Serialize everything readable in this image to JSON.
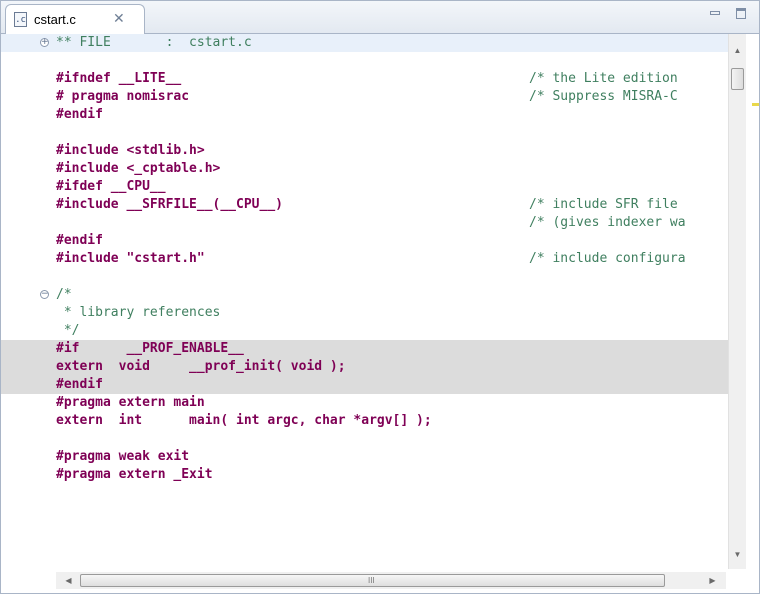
{
  "tab": {
    "icon": "c-source-file-icon",
    "icon_letter": ".c",
    "title": "cstart.c",
    "close_glyph": "✕"
  },
  "window": {
    "minimize": "minimize-icon",
    "maximize": "maximize-icon"
  },
  "scroll": {
    "up": "▲",
    "down": "▼",
    "left": "◀",
    "right": "▶",
    "grip": "III"
  },
  "editor": {
    "lines": [
      {
        "code": "** FILE       :  cstart.c"
      },
      {
        "code": ""
      },
      {
        "code": "#ifndef __LITE__",
        "comment": "/* the Lite edition"
      },
      {
        "code": "# pragma nomisrac",
        "comment": "/* Suppress MISRA-C"
      },
      {
        "code": "#endif"
      },
      {
        "code": ""
      },
      {
        "code": "#include <stdlib.h>"
      },
      {
        "code": "#include <_cptable.h>"
      },
      {
        "code": "#ifdef __CPU__"
      },
      {
        "code": "#include __SFRFILE__(__CPU__)",
        "comment": "/* include SFR file"
      },
      {
        "code": "",
        "comment": "/* (gives indexer wa"
      },
      {
        "code": "#endif"
      },
      {
        "code": "#include \"cstart.h\"",
        "comment": "/* include configura"
      },
      {
        "code": ""
      },
      {
        "code": "/*"
      },
      {
        "code": " * library references"
      },
      {
        "code": " */"
      },
      {
        "code": "#if      __PROF_ENABLE__"
      },
      {
        "code": "extern  void     __prof_init( void );"
      },
      {
        "code": "#endif"
      },
      {
        "code": "#pragma extern main"
      },
      {
        "code": "extern  int      main( int argc, char *argv[] );"
      },
      {
        "code": ""
      },
      {
        "code": "#pragma weak exit"
      },
      {
        "code": "#pragma extern _Exit"
      }
    ]
  },
  "colors": {
    "keyword": "#7f0055",
    "string": "#2a00ff",
    "comment": "#3f7f5f",
    "highlight": "#dcdcdc"
  }
}
